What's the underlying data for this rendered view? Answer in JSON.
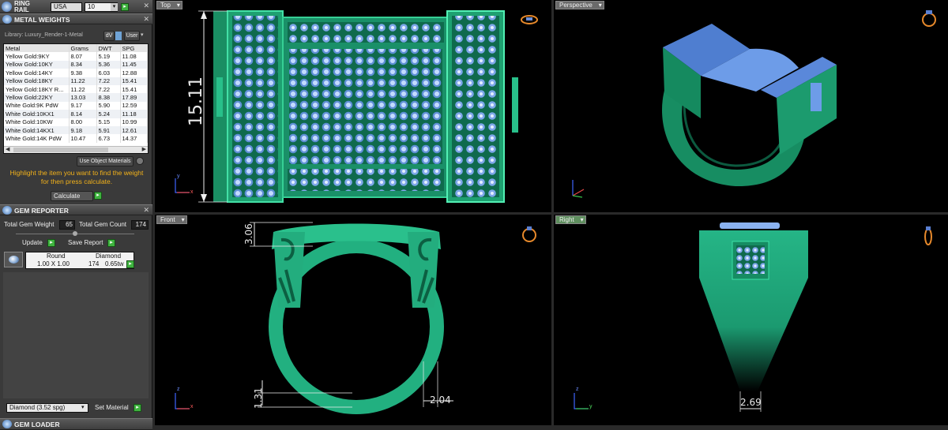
{
  "ring_rail": {
    "title": "RING RAIL",
    "country": "USA",
    "size": "10"
  },
  "metal_weights": {
    "title": "METAL WEIGHTS",
    "library": "Library: Luxury_Render-1-Metal",
    "dv": "dV",
    "user": "User",
    "columns": [
      "Metal",
      "Grams",
      "DWT",
      "SPG"
    ],
    "rows": [
      [
        "Yellow Gold:9KY",
        "8.07",
        "5.19",
        "11.08"
      ],
      [
        "Yellow Gold:10KY",
        "8.34",
        "5.36",
        "11.45"
      ],
      [
        "Yellow Gold:14KY",
        "9.38",
        "6.03",
        "12.88"
      ],
      [
        "Yellow Gold:18KY",
        "11.22",
        "7.22",
        "15.41"
      ],
      [
        "Yellow Gold:18KY R...",
        "11.22",
        "7.22",
        "15.41"
      ],
      [
        "Yellow Gold:22KY",
        "13.03",
        "8.38",
        "17.89"
      ],
      [
        "White Gold:9K PdW",
        "9.17",
        "5.90",
        "12.59"
      ],
      [
        "White Gold:10KX1",
        "8.14",
        "5.24",
        "11.18"
      ],
      [
        "White Gold:10KW",
        "8.00",
        "5.15",
        "10.99"
      ],
      [
        "White Gold:14KX1",
        "9.18",
        "5.91",
        "12.61"
      ],
      [
        "White Gold:14K PdW",
        "10.47",
        "6.73",
        "14.37"
      ]
    ],
    "use_object": "Use Object Materials",
    "hint": "Highlight the item you want to find the weight for then press calculate.",
    "calculate": "Calculate"
  },
  "gem_reporter": {
    "title": "GEM REPORTER",
    "total_weight_label": "Total Gem Weight",
    "total_weight": "65",
    "total_count_label": "Total Gem Count",
    "total_count": "174",
    "update": "Update",
    "save_report": "Save Report",
    "gem_headers": [
      "Round",
      "Diamond"
    ],
    "gem_size": "1.00 X 1.00",
    "gem_count": "174",
    "gem_tw": "0.65tw"
  },
  "material": {
    "select": "Diamond    (3.52 spg)",
    "set": "Set Material"
  },
  "gem_loader": {
    "title": "GEM LOADER"
  },
  "viewports": {
    "top": "Top",
    "perspective": "Perspective",
    "front": "Front",
    "right": "Right"
  },
  "dimensions": {
    "top_height": "15.11",
    "front_top": "3.06",
    "front_bottom": "1.31",
    "front_width": "2.04",
    "right_width": "2.69"
  },
  "axes": {
    "y": "y",
    "x": "x",
    "z": "z"
  },
  "colors": {
    "ring": "#1fa47a",
    "gem": "#8fb7ff",
    "panel": "#3a3a3a"
  }
}
